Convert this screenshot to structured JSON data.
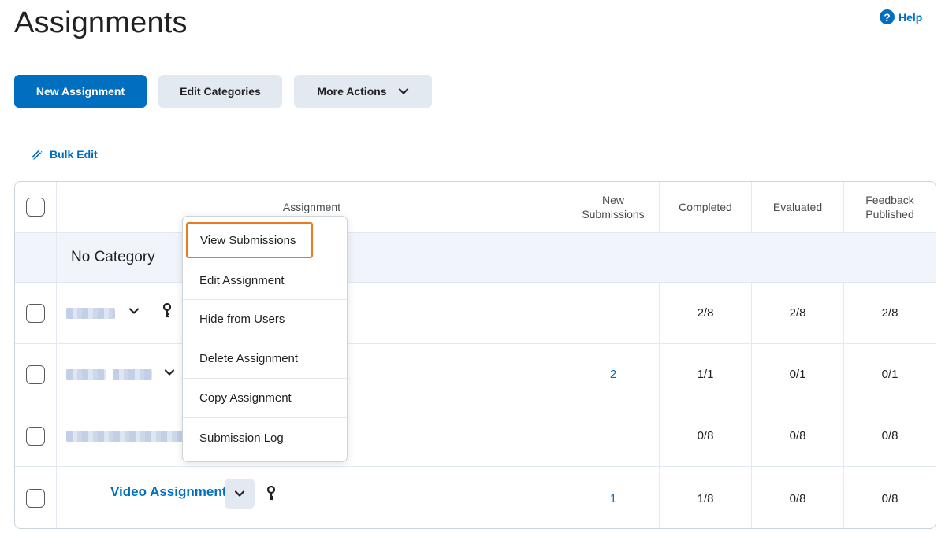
{
  "page": {
    "title": "Assignments",
    "help_label": "Help"
  },
  "toolbar": {
    "new_assignment": "New Assignment",
    "edit_categories": "Edit Categories",
    "more_actions": "More Actions",
    "bulk_edit": "Bulk Edit"
  },
  "table": {
    "headers": {
      "assignment": "Assignment",
      "new_submissions_1": "New",
      "new_submissions_2": "Submissions",
      "completed": "Completed",
      "evaluated": "Evaluated",
      "feedback_1": "Feedback",
      "feedback_2": "Published"
    },
    "category": "No Category",
    "rows": [
      {
        "name": "",
        "new_submissions": "",
        "completed": "2/8",
        "evaluated": "2/8",
        "feedback": "2/8"
      },
      {
        "name": "",
        "new_submissions": "2",
        "completed": "1/1",
        "evaluated": "0/1",
        "feedback": "0/1"
      },
      {
        "name": "",
        "new_submissions": "",
        "completed": "0/8",
        "evaluated": "0/8",
        "feedback": "0/8"
      },
      {
        "name": "Video Assignment",
        "new_submissions": "1",
        "completed": "1/8",
        "evaluated": "0/8",
        "feedback": "0/8"
      }
    ]
  },
  "context_menu": {
    "items": [
      "View Submissions",
      "Edit Assignment",
      "Hide from Users",
      "Delete Assignment",
      "Copy Assignment",
      "Submission Log"
    ]
  },
  "colors": {
    "primary": "#006fbf",
    "secondary_bg": "#e3e9f1",
    "highlight": "#ef7a1c",
    "category_bg": "#f1f5fb"
  }
}
